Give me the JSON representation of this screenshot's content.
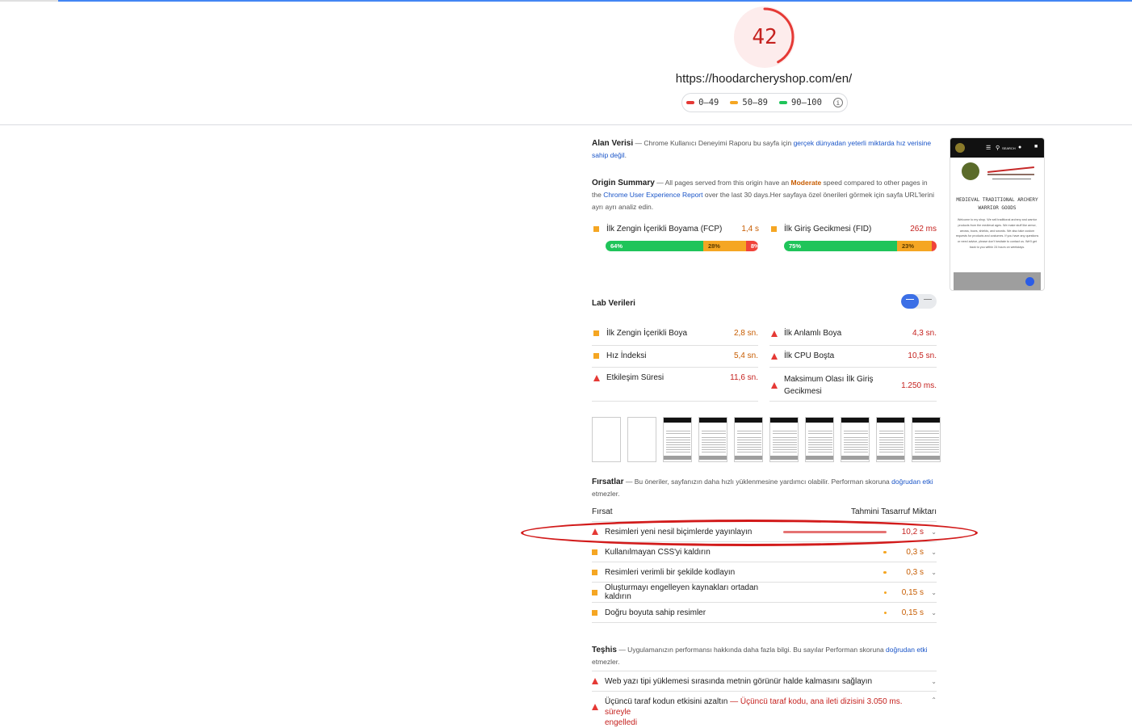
{
  "header": {
    "score": "42",
    "url": "https://hoodarcheryshop.com/en/",
    "legend": [
      {
        "label": "0–49",
        "color": "#e53935"
      },
      {
        "label": "50–89",
        "color": "#f5a623"
      },
      {
        "label": "90–100",
        "color": "#1fc45a"
      }
    ],
    "info_icon": "info-icon"
  },
  "field": {
    "title": "Alan Verisi",
    "desc_prefix": "— Chrome Kullanıcı Deneyimi Raporu bu sayfa için ",
    "desc_link": "gerçek dünyadan yeterli miktarda hız verisine sahip değil",
    "desc_suffix": "."
  },
  "origin": {
    "title": "Origin Summary",
    "desc_a": "— All pages served from this origin have an ",
    "moderate": "Moderate",
    "desc_b": " speed compared to other pages in the ",
    "link": "Chrome User Experience Report",
    "desc_c": " over the last 30 days.Her sayfaya özel önerileri görmek için sayfa URL'lerini ayrı ayrı analiz edin.",
    "fcp": {
      "label": "İlk Zengin İçerikli Boyama (FCP)",
      "value": "1,4 s",
      "dist": [
        "64%",
        "28%",
        "8%"
      ],
      "dist_values": [
        64,
        28,
        8
      ]
    },
    "fid": {
      "label": "İlk Giriş Gecikmesi (FID)",
      "value": "262 ms",
      "dist": [
        "75%",
        "23%",
        "2%"
      ],
      "dist_values": [
        75,
        23,
        2
      ]
    }
  },
  "lab": {
    "title": "Lab Verileri",
    "metrics_left": [
      {
        "label": "İlk Zengin İçerikli Boya",
        "value": "2,8 sn.",
        "kind": "average"
      },
      {
        "label": "Hız İndeksi",
        "value": "5,4 sn.",
        "kind": "average"
      },
      {
        "label": "Etkileşim Süresi",
        "value": "11,6 sn.",
        "kind": "fail"
      }
    ],
    "metrics_right": [
      {
        "label": "İlk Anlamlı Boya",
        "value": "4,3 sn.",
        "kind": "fail"
      },
      {
        "label": "İlk CPU Boşta",
        "value": "10,5 sn.",
        "kind": "fail"
      },
      {
        "label_1": "Maksimum Olası İlk Giriş",
        "label_2": "Gecikmesi",
        "value": "1.250 ms.",
        "kind": "fail"
      }
    ]
  },
  "opportunities": {
    "title": "Fırsatlar",
    "desc_a": "— Bu öneriler, sayfanızın daha hızlı yüklenmesine yardımcı olabilir. Performan skoruna ",
    "desc_link": "doğrudan etki",
    "desc_b": " etmezler.",
    "col_left": "Fırsat",
    "col_right": "Tahmini Tasarruf Miktarı",
    "rows": [
      {
        "label": "Resimleri yeni nesil biçimlerde yayınlayın",
        "saving": "10,2 s",
        "kind": "fail",
        "fraction": 1.0
      },
      {
        "label": "Kullanılmayan CSS'yi kaldırın",
        "saving": "0,3 s",
        "kind": "average",
        "fraction": 0.03
      },
      {
        "label": "Resimleri verimli bir şekilde kodlayın",
        "saving": "0,3 s",
        "kind": "average",
        "fraction": 0.03
      },
      {
        "label": "Oluşturmayı engelleyen kaynakları ortadan kaldırın",
        "saving": "0,15 s",
        "kind": "average",
        "fraction": 0.015
      },
      {
        "label": "Doğru boyuta sahip resimler",
        "saving": "0,15 s",
        "kind": "average",
        "fraction": 0.015
      }
    ]
  },
  "diagnostics": {
    "title": "Teşhis",
    "desc_a": "— Uygulamanızın performansı hakkında daha fazla bilgi. Bu sayılar Performan skoruna ",
    "desc_link": "doğrudan etki",
    "desc_b": " etmezler.",
    "row1": "Web yazı tipi yüklemesi sırasında metnin görünür halde kalmasını sağlayın",
    "row2_label": "Üçüncü taraf kodun etkisini azaltın",
    "row2_detail_1": "— Üçüncü taraf kodu, ana ileti dizisini 3.050 ms. süreyle",
    "row2_detail_2": "engelledi"
  },
  "preview": {
    "title_1": "MEDIEVAL TRADITIONAL ARCHERY",
    "title_2": "WARRIOR GOODS",
    "text": "Welcome to my shop. We sell traditional archery and warrior products from the medieval ages. We make stuff like armor, arrows, bows, shields, and swords. We also take custom requests for products and costumes. If you have any questions or need advice, please don't hesitate to contact us. We'll get back to you within 24 hours on weekdays.",
    "nav_label": "SEARCH"
  },
  "colors": {
    "fail": "#c5221f",
    "average": "#c75c00",
    "pass": "#1fc45a",
    "accent": "#4285f4",
    "annotation": "#d21b1b"
  }
}
